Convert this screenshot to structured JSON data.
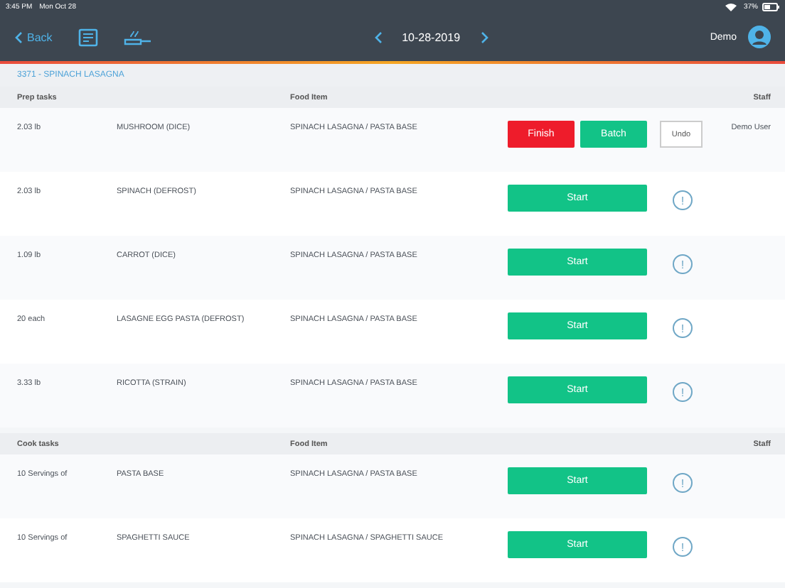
{
  "status_bar": {
    "time": "3:45 PM",
    "date": "Mon Oct 28",
    "battery_text": "37%"
  },
  "header": {
    "back": "Back",
    "date": "10-28-2019",
    "user": "Demo"
  },
  "recipe_title": "3371 - SPINACH LASAGNA",
  "sections": [
    {
      "title": "Prep tasks",
      "food_heading": "Food Item",
      "staff_heading": "Staff",
      "rows": [
        {
          "qty": "2.03 lb",
          "name": "MUSHROOM (DICE)",
          "food": "SPINACH LASAGNA / PASTA BASE",
          "kind": "in_progress",
          "buttons": [
            "Finish",
            "Batch",
            "Undo"
          ],
          "staff": "Demo User"
        },
        {
          "qty": "2.03 lb",
          "name": "SPINACH (DEFROST)",
          "food": "SPINACH LASAGNA / PASTA BASE",
          "kind": "pending",
          "start": "Start",
          "alert": "!"
        },
        {
          "qty": "1.09 lb",
          "name": "CARROT (DICE)",
          "food": "SPINACH LASAGNA / PASTA BASE",
          "kind": "pending",
          "start": "Start",
          "alert": "!"
        },
        {
          "qty": "20 each",
          "name": "LASAGNE EGG PASTA (DEFROST)",
          "food": "SPINACH LASAGNA / PASTA BASE",
          "kind": "pending",
          "start": "Start",
          "alert": "!"
        },
        {
          "qty": "3.33 lb",
          "name": "RICOTTA (STRAIN)",
          "food": "SPINACH LASAGNA / PASTA BASE",
          "kind": "pending",
          "start": "Start",
          "alert": "!"
        }
      ]
    },
    {
      "title": "Cook tasks",
      "food_heading": "Food Item",
      "staff_heading": "Staff",
      "rows": [
        {
          "qty": "10 Servings of",
          "name": "PASTA BASE",
          "food": "SPINACH LASAGNA / PASTA BASE",
          "kind": "pending",
          "start": "Start",
          "alert": "!"
        },
        {
          "qty": "10 Servings of",
          "name": "SPAGHETTI SAUCE",
          "food": "SPINACH LASAGNA / SPAGHETTI SAUCE",
          "kind": "pending",
          "start": "Start",
          "alert": "!"
        }
      ]
    }
  ]
}
